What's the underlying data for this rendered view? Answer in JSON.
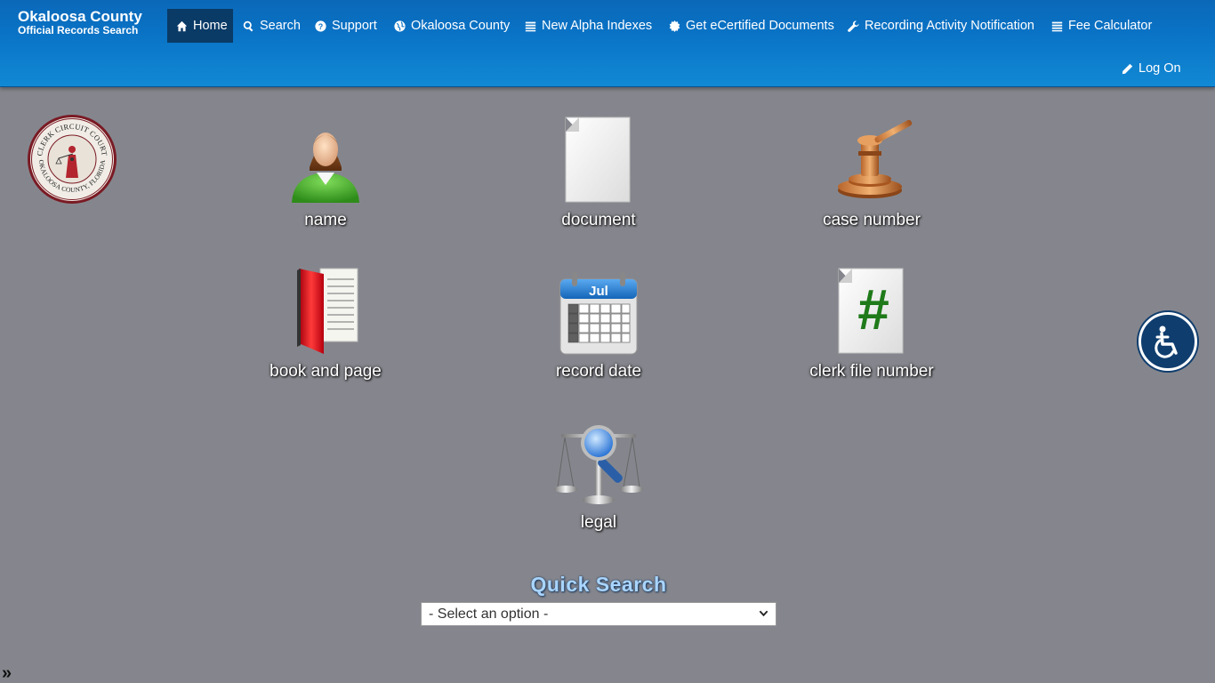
{
  "header": {
    "brand_title": "Okaloosa County",
    "brand_subtitle": "Official Records Search",
    "nav": [
      {
        "label": "Home",
        "icon": "home-icon"
      },
      {
        "label": "Search",
        "icon": "search-icon"
      },
      {
        "label": "Support",
        "icon": "question-circle-icon"
      },
      {
        "label": "Okaloosa County",
        "icon": "globe-icon"
      },
      {
        "label": "New Alpha Indexes",
        "icon": "list-icon"
      },
      {
        "label": "Get eCertified Documents",
        "icon": "certificate-icon"
      },
      {
        "label": "Recording Activity Notification",
        "icon": "wrench-icon"
      },
      {
        "label": "Fee Calculator",
        "icon": "list-icon"
      }
    ],
    "logon_label": "Log On",
    "active_color": "#0a3a66",
    "bar_color": "#0a73c6"
  },
  "seal": {
    "top_text": "CLERK CIRCUIT COURT",
    "bottom_text": "OKALOOSA COUNTY, FLORIDA"
  },
  "tiles": [
    {
      "label": "name",
      "icon": "person-icon"
    },
    {
      "label": "document",
      "icon": "document-icon"
    },
    {
      "label": "case number",
      "icon": "gavel-icon"
    },
    {
      "label": "book and page",
      "icon": "book-icon"
    },
    {
      "label": "record date",
      "icon": "calendar-icon"
    },
    {
      "label": "clerk file number",
      "icon": "hash-document-icon"
    },
    {
      "label": "legal",
      "icon": "scales-magnifier-icon"
    }
  ],
  "calendar_month": "Jul",
  "hash_symbol": "#",
  "quick_search": {
    "title": "Quick Search",
    "selected": "- Select an option -"
  },
  "expander": "»",
  "accessibility": {
    "icon": "accessibility-icon"
  }
}
